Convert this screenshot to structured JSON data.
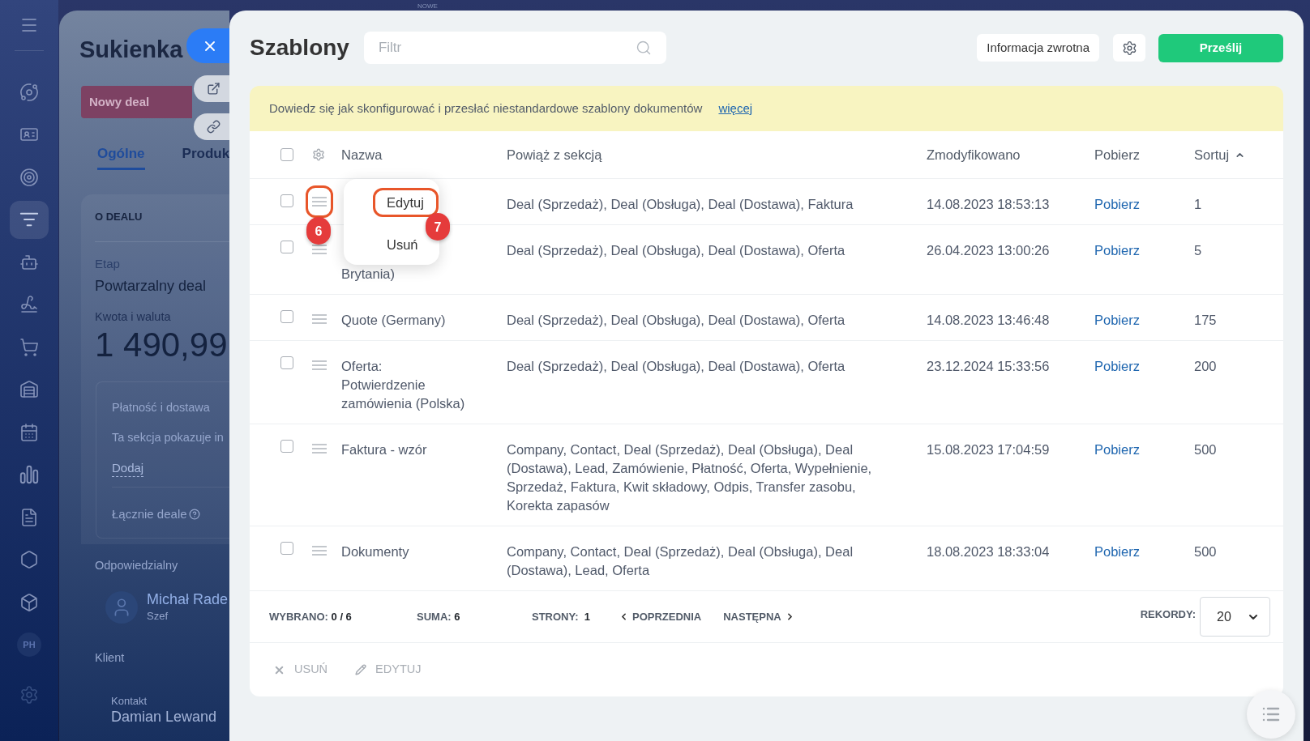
{
  "sidebar": {
    "items": [
      {
        "selected": false
      },
      {
        "selected": false
      },
      {
        "selected": false
      },
      {
        "selected": true
      },
      {
        "selected": false
      },
      {
        "selected": false
      },
      {
        "selected": false
      },
      {
        "selected": false
      },
      {
        "selected": false
      },
      {
        "selected": false
      },
      {
        "selected": false
      },
      {
        "selected": false
      },
      {
        "selected": false
      }
    ],
    "avatar": {
      "initials": "PH"
    }
  },
  "top_bar": {
    "label": "NOWE"
  },
  "deal_panel": {
    "title": "Sukienka",
    "stage": "Nowy deal",
    "tabs": [
      {
        "label": "Ogólne",
        "selected": true
      },
      {
        "label": "Produk",
        "selected": false
      }
    ],
    "section_title": "O DEALU",
    "stage_label": "Etap",
    "stage_value": "Powtarzalny deal",
    "amount_label": "Kwota i waluta",
    "amount": "1 490,99",
    "payment": {
      "title": "Płatność i dostawa",
      "text": "Ta sekcja pokazuje in",
      "link": "Dodaj",
      "total_label": "Łącznie deale"
    },
    "responsible_label": "Odpowiedzialny",
    "responsible": {
      "name": "Michał Rade",
      "role": "Szef"
    },
    "client_label": "Klient",
    "contact_label": "Kontakt",
    "contact_name": "Damian Lewand"
  },
  "templates": {
    "title": "Szablony",
    "filter": {
      "placeholder": "Filtr"
    },
    "feedback_button": "Informacja zwrotna",
    "upload_button": "Prześlij",
    "notice": {
      "text": "Dowiedz się jak skonfigurować i przesłać niestandardowe szablony dokumentów",
      "link": "więcej"
    },
    "table": {
      "select_all_checked": false,
      "columns": [
        {
          "label": "Nazwa"
        },
        {
          "label": "Powiąż z sekcją"
        },
        {
          "label": "Zmodyfikowano"
        },
        {
          "label": "Pobierz"
        },
        {
          "label": "Sortuj",
          "sort_ascending": true
        }
      ],
      "rows": [
        {
          "checked": false,
          "callout": "6",
          "sections": "Deal (Sprzedaż), Deal (Obsługa), Deal (Dostawa), Faktura",
          "modified": "14.08.2023 18:53:13",
          "download": "Pobierz",
          "sort": "1",
          "menu": {
            "items": [
              {
                "label": "Edytuj",
                "callout": "7"
              },
              {
                "label": "Usuń"
              }
            ]
          }
        },
        {
          "checked": false,
          "name": "Brytania)",
          "sections": "Deal (Sprzedaż), Deal (Obsługa), Deal (Dostawa), Oferta",
          "modified": "26.04.2023 13:00:26",
          "download": "Pobierz",
          "sort": "5"
        },
        {
          "checked": false,
          "name": "Quote (Germany)",
          "sections": "Deal (Sprzedaż), Deal (Obsługa), Deal (Dostawa), Oferta",
          "modified": "14.08.2023 13:46:48",
          "download": "Pobierz",
          "sort": "175"
        },
        {
          "checked": false,
          "name": "Oferta:\nPotwierdzenie\nzamówienia (Polska)",
          "sections": "Deal (Sprzedaż), Deal (Obsługa), Deal (Dostawa), Oferta",
          "modified": "23.12.2024 15:33:56",
          "download": "Pobierz",
          "sort": "200"
        },
        {
          "checked": false,
          "name": "Faktura - wzór",
          "sections": "Company, Contact, Deal (Sprzedaż), Deal (Obsługa), Deal\n(Dostawa), Lead, Zamówienie, Płatność, Oferta, Wypełnienie,\nSprzedaż, Faktura, Kwit składowy, Odpis, Transfer zasobu,\nKorekta zapasów",
          "modified": "15.08.2023 17:04:59",
          "download": "Pobierz",
          "sort": "500"
        },
        {
          "checked": false,
          "name": "Dokumenty",
          "sections": "Company, Contact, Deal (Sprzedaż), Deal (Obsługa), Deal\n(Dostawa), Lead, Oferta",
          "modified": "18.08.2023 18:33:04",
          "download": "Pobierz",
          "sort": "500"
        }
      ]
    },
    "pagination": {
      "selected": "WYBRANO: **0 / 6**",
      "total": "SUMA: **6**",
      "pages": "STRONY:  **1**",
      "prev": "POPRZEDNIA",
      "next": "NASTĘPNA",
      "records_label": "REKORDY:",
      "records": "20"
    },
    "actions": [
      {
        "kind": "delete",
        "label": "USUŃ",
        "disabled": true
      },
      {
        "kind": "edit",
        "label": "EDYTUJ",
        "disabled": true
      }
    ]
  }
}
